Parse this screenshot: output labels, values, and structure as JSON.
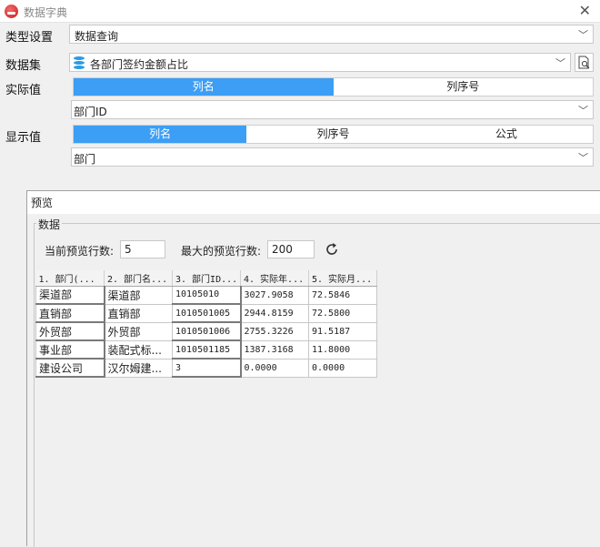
{
  "window": {
    "title": "数据字典"
  },
  "type_setting": {
    "label": "类型设置",
    "value": "数据查询"
  },
  "dataset": {
    "label": "数据集",
    "value": "各部门签约金额占比"
  },
  "actual_value": {
    "label": "实际值",
    "tabs": [
      {
        "label": "列名",
        "active": true
      },
      {
        "label": "列序号",
        "active": false
      }
    ],
    "field_value": "部门ID"
  },
  "display_value": {
    "label": "显示值",
    "tabs": [
      {
        "label": "列名",
        "active": true
      },
      {
        "label": "列序号",
        "active": false
      },
      {
        "label": "公式",
        "active": false
      }
    ],
    "field_value": "部门"
  },
  "preview": {
    "title": "预览",
    "group_label": "数据",
    "current_rows_label": "当前预览行数:",
    "current_rows": "5",
    "max_rows_label": "最大的预览行数:",
    "max_rows": "200",
    "columns": [
      "1. 部门(...",
      "2. 部门名...",
      "3. 部门ID...",
      "4. 实际年...",
      "5. 实际月..."
    ],
    "rows": [
      [
        "渠道部",
        "渠道部",
        "10105010",
        "3027.9058",
        "72.5846"
      ],
      [
        "直销部",
        "直销部",
        "1010501005",
        "2944.8159",
        "72.5800"
      ],
      [
        "外贸部",
        "外贸部",
        "1010501006",
        "2755.3226",
        "91.5187"
      ],
      [
        "事业部",
        "装配式标...",
        "1010501185",
        "1387.3168",
        "11.8000"
      ],
      [
        "建设公司",
        "汉尔姆建...",
        "3",
        "0.0000",
        "0.0000"
      ]
    ]
  },
  "colors": {
    "accent": "#3c9ef5",
    "dataset_icon": "#2a9be8"
  }
}
